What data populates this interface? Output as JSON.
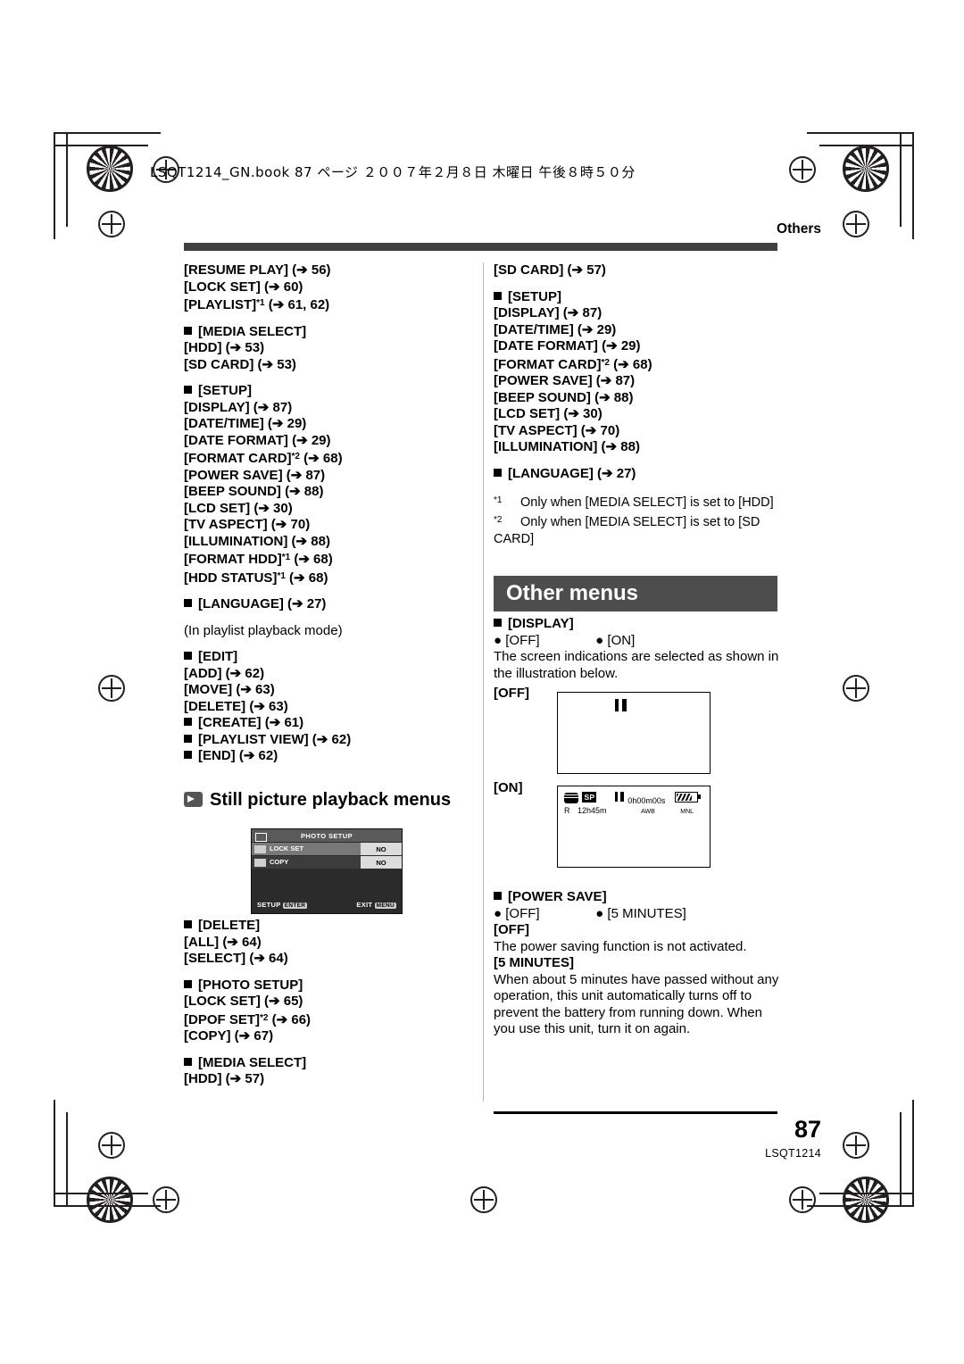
{
  "header": {
    "file_line": "LSQT1214_GN.book  87 ページ  ２００７年２月８日  木曜日  午後８時５０分",
    "section_label": "Others"
  },
  "left_column": {
    "top_items": [
      "[RESUME PLAY] (➔ 56)",
      "[LOCK SET] (➔ 60)",
      "[PLAYLIST]*1 (➔ 61, 62)"
    ],
    "media_select_heading": "[MEDIA SELECT]",
    "media_select_items": [
      "[HDD] (➔ 53)",
      "[SD CARD] (➔ 53)"
    ],
    "setup_heading": "[SETUP]",
    "setup_items": [
      "[DISPLAY] (➔ 87)",
      "[DATE/TIME] (➔ 29)",
      "[DATE FORMAT] (➔ 29)",
      "[FORMAT CARD]*2 (➔ 68)",
      "[POWER SAVE] (➔ 87)",
      "[BEEP SOUND] (➔ 88)",
      "[LCD SET] (➔ 30)",
      "[TV ASPECT] (➔ 70)",
      "[ILLUMINATION] (➔ 88)",
      "[FORMAT HDD]*1 (➔ 68)",
      "[HDD STATUS]*1 (➔ 68)"
    ],
    "language_heading": "[LANGUAGE] (➔ 27)",
    "playlist_note": "(In playlist playback mode)",
    "edit_heading": "[EDIT]",
    "edit_items": [
      "[ADD] (➔ 62)",
      "[MOVE] (➔ 63)",
      "[DELETE] (➔ 63)"
    ],
    "after_edit": [
      "[CREATE] (➔ 61)",
      "[PLAYLIST VIEW] (➔ 62)",
      "[END] (➔ 62)"
    ],
    "still_heading": "Still picture playback menus",
    "delete_heading": "[DELETE]",
    "delete_items": [
      "[ALL] (➔ 64)",
      "[SELECT] (➔ 64)"
    ],
    "photo_setup_heading": "[PHOTO SETUP]",
    "photo_setup_items": [
      "[LOCK SET] (➔ 65)",
      "[DPOF SET]*2 (➔ 66)",
      "[COPY] (➔ 67)"
    ],
    "media_select2_heading": "[MEDIA SELECT]",
    "media_select2_items": [
      "[HDD] (➔ 57)"
    ]
  },
  "lcd_photo_setup": {
    "title": "PHOTO SETUP",
    "rows": [
      {
        "label": "LOCK SET",
        "value": "NO"
      },
      {
        "label": "COPY",
        "value": "NO"
      }
    ],
    "footer_left": "SETUP",
    "footer_left_key": "ENTER",
    "footer_right": "EXIT",
    "footer_right_key": "MENU"
  },
  "right_column": {
    "sd_card_item": "[SD CARD] (➔ 57)",
    "setup_heading": "[SETUP]",
    "setup_items": [
      "[DISPLAY] (➔ 87)",
      "[DATE/TIME] (➔ 29)",
      "[DATE FORMAT] (➔ 29)",
      "[FORMAT CARD]*2 (➔ 68)",
      "[POWER SAVE] (➔ 87)",
      "[BEEP SOUND] (➔ 88)",
      "[LCD SET] (➔ 30)",
      "[TV ASPECT] (➔ 70)",
      "[ILLUMINATION] (➔ 88)"
    ],
    "language_heading": "[LANGUAGE] (➔ 27)",
    "footnotes": [
      {
        "index": "*1",
        "text": "Only when [MEDIA SELECT] is set to [HDD]"
      },
      {
        "index": "*2",
        "text": "Only when [MEDIA SELECT] is set to [SD CARD]"
      }
    ],
    "banner_title": "Other menus",
    "display_heading": "[DISPLAY]",
    "display_options": [
      "[OFF]",
      "[ON]"
    ],
    "display_desc": "The screen indications are selected as shown in the illustration below.",
    "off_label": "[OFF]",
    "on_label": "[ON]",
    "power_save_heading": "[POWER SAVE]",
    "power_save_options": [
      "[OFF]",
      "[5 MINUTES]"
    ],
    "off_label2": "[OFF]",
    "off_desc": "The power saving function is not activated.",
    "minutes_label": "[5 MINUTES]",
    "minutes_desc": "When about 5 minutes have passed without any operation, this unit automatically turns off to prevent the battery from running down. When you use this unit, turn it on again."
  },
  "lcd_on": {
    "mode_badge": "SP",
    "timecode": "0h00m00s",
    "remain_label": "R",
    "remain_value": "12h45m",
    "indicator_left": "AWB",
    "indicator_right": "MNL"
  },
  "footer": {
    "page_number": "87",
    "doc_code": "LSQT1214"
  }
}
